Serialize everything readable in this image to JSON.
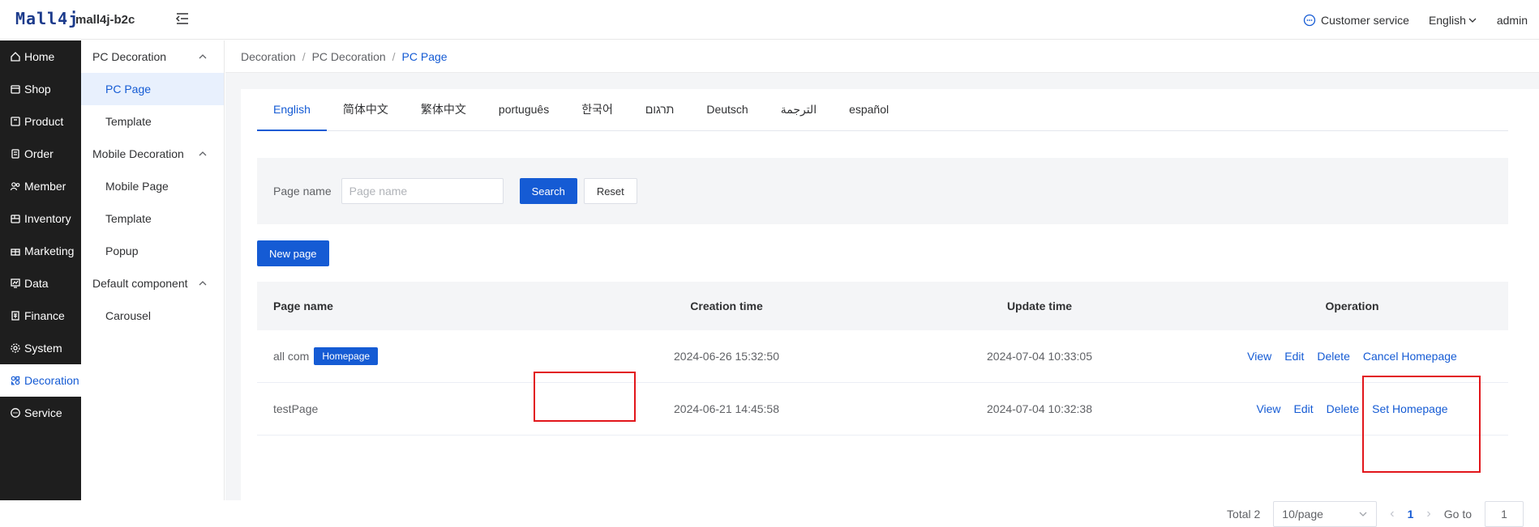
{
  "header": {
    "logo": "Mall4j",
    "app_name": "mall4j-b2c",
    "customer_service": "Customer service",
    "language": "English",
    "user": "admin"
  },
  "nav": {
    "items": [
      {
        "label": "Home",
        "icon": "home-icon"
      },
      {
        "label": "Shop",
        "icon": "shop-icon"
      },
      {
        "label": "Product",
        "icon": "product-icon"
      },
      {
        "label": "Order",
        "icon": "order-icon"
      },
      {
        "label": "Member",
        "icon": "member-icon"
      },
      {
        "label": "Inventory",
        "icon": "inventory-icon"
      },
      {
        "label": "Marketing",
        "icon": "gift-icon"
      },
      {
        "label": "Data",
        "icon": "chart-icon"
      },
      {
        "label": "Finance",
        "icon": "finance-icon"
      },
      {
        "label": "System",
        "icon": "gear-icon"
      },
      {
        "label": "Decoration",
        "icon": "decoration-icon"
      },
      {
        "label": "Service",
        "icon": "chat-icon"
      }
    ],
    "active_index": 10
  },
  "subnav": {
    "pc_group": "PC Decoration",
    "pc_page": "PC Page",
    "pc_template": "Template",
    "mobile_group": "Mobile Decoration",
    "mobile_page": "Mobile Page",
    "mobile_template": "Template",
    "popup": "Popup",
    "default_group": "Default component",
    "carousel": "Carousel"
  },
  "breadcrumb": {
    "b1": "Decoration",
    "b2": "PC Decoration",
    "b3": "PC Page",
    "sep": "/"
  },
  "tabs": [
    "English",
    "简体中文",
    "繁体中文",
    "português",
    "한국어",
    "תרגום",
    "Deutsch",
    "الترجمة",
    "español"
  ],
  "search": {
    "label": "Page name",
    "placeholder": "Page name",
    "search_btn": "Search",
    "reset_btn": "Reset"
  },
  "new_page_btn": "New page",
  "table": {
    "headers": {
      "name": "Page name",
      "created": "Creation time",
      "updated": "Update time",
      "operation": "Operation"
    },
    "rows": [
      {
        "name": "all com",
        "badge": "Homepage",
        "created": "2024-06-26 15:32:50",
        "updated": "2024-07-04 10:33:05",
        "view": "View",
        "edit": "Edit",
        "delete": "Delete",
        "home_action": "Cancel Homepage"
      },
      {
        "name": "testPage",
        "badge": "",
        "created": "2024-06-21 14:45:58",
        "updated": "2024-07-04 10:32:38",
        "view": "View",
        "edit": "Edit",
        "delete": "Delete",
        "home_action": "Set Homepage"
      }
    ]
  },
  "pager": {
    "total": "Total 2",
    "page_size": "10/page",
    "current": "1",
    "goto_label": "Go to",
    "goto_value": "1"
  }
}
